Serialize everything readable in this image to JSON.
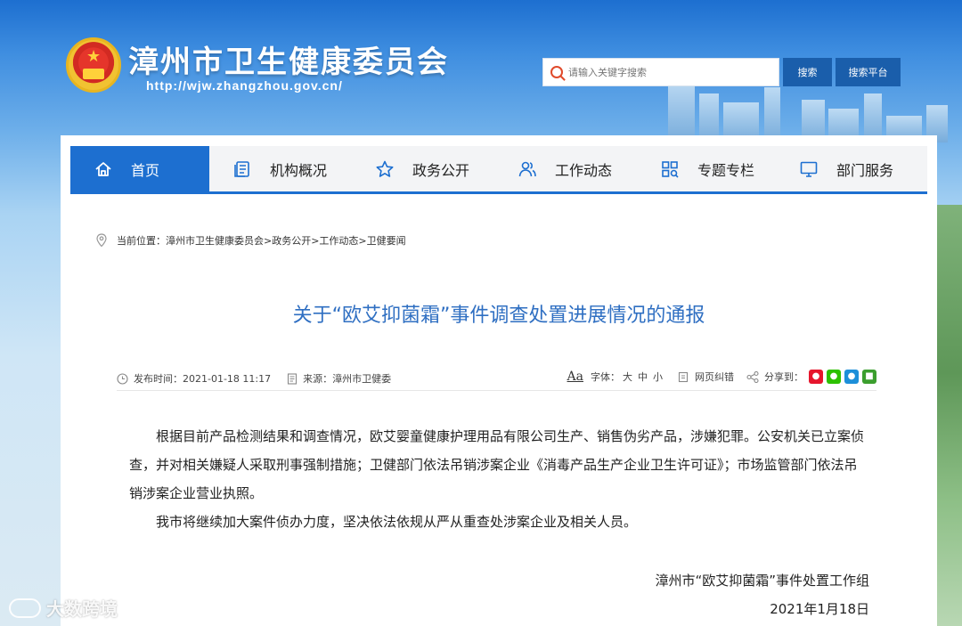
{
  "header": {
    "site_title": "漳州市卫生健康委员会",
    "site_url": "http://wjw.zhangzhou.gov.cn/",
    "search_placeholder": "请输入关键字搜索",
    "search_button": "搜索",
    "search_platform_button": "搜索平台"
  },
  "nav": {
    "items": [
      {
        "label": "首页",
        "icon": "home-icon"
      },
      {
        "label": "机构概况",
        "icon": "document-list-icon"
      },
      {
        "label": "政务公开",
        "icon": "star-icon"
      },
      {
        "label": "工作动态",
        "icon": "people-icon"
      },
      {
        "label": "专题专栏",
        "icon": "grid-search-icon"
      },
      {
        "label": "部门服务",
        "icon": "monitor-icon"
      }
    ]
  },
  "breadcrumb": {
    "text": "当前位置：漳州市卫生健康委员会>政务公开>工作动态>卫健要闻"
  },
  "article": {
    "title": "关于“欧艾抑菌霜”事件调查处置进展情况的通报",
    "publish_time": "发布时间：2021-01-18 11:17",
    "source": "来源：漳州市卫健委",
    "font_label": "字体：",
    "font_aa": "Aa",
    "font_sizes": [
      "大",
      "中",
      "小"
    ],
    "error_report": "网页纠错",
    "share_label": "分享到：",
    "paragraphs": [
      "根据目前产品检测结果和调查情况，欧艾婴童健康护理用品有限公司生产、销售伪劣产品，涉嫌犯罪。公安机关已立案侦查，并对相关嫌疑人采取刑事强制措施；卫健部门依法吊销涉案企业《消毒产品生产企业卫生许可证》；市场监管部门依法吊销涉案企业营业执照。",
      "我市将继续加大案件侦办力度，坚决依法依规从严从重查处涉案企业及相关人员。"
    ],
    "signature": "漳州市“欧艾抑菌霜”事件处置工作组",
    "date": "2021年1月18日"
  },
  "watermark": {
    "text": "大数跨境"
  },
  "colors": {
    "primary_blue": "#1d6fd0",
    "button_blue": "#1a5eab",
    "title_blue": "#2f6fc2"
  }
}
